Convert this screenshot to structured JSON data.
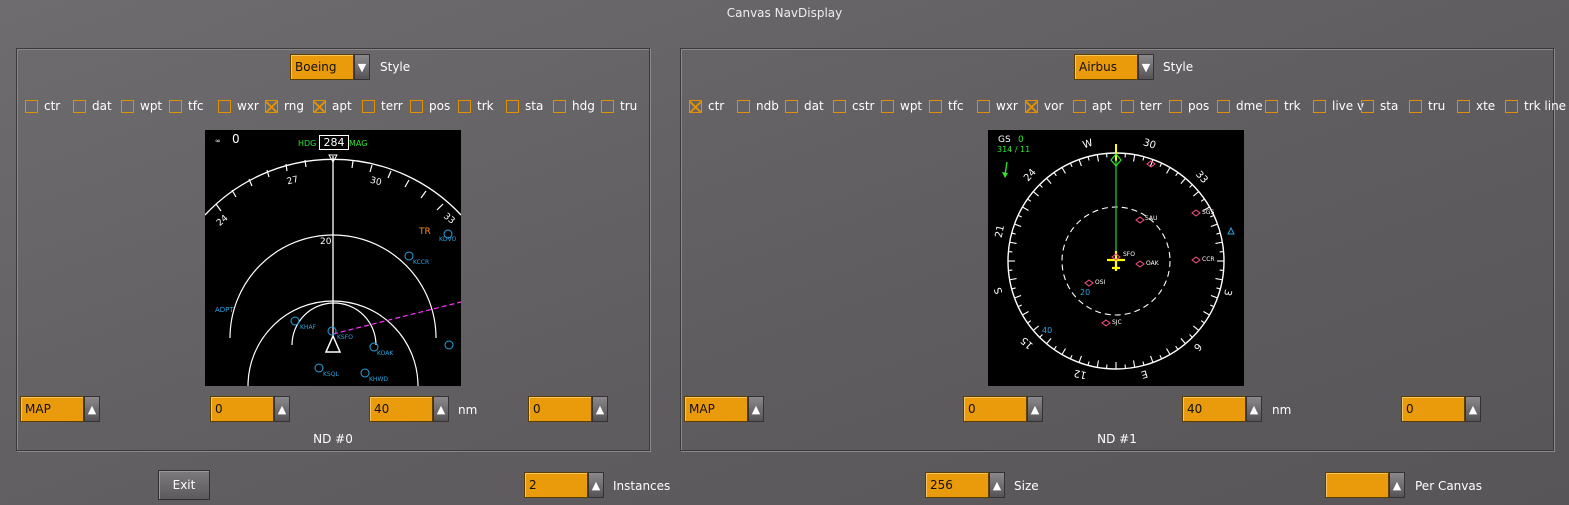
{
  "window": {
    "title": "Canvas NavDisplay"
  },
  "nd0": {
    "style": {
      "value": "Boeing",
      "label": "Style"
    },
    "checkboxes": [
      {
        "label": "ctr",
        "checked": false
      },
      {
        "label": "dat",
        "checked": false
      },
      {
        "label": "wpt",
        "checked": false
      },
      {
        "label": "tfc",
        "checked": false
      },
      {
        "label": "wxr",
        "checked": false
      },
      {
        "label": "rng",
        "checked": true
      },
      {
        "label": "apt",
        "checked": true
      },
      {
        "label": "terr",
        "checked": false
      },
      {
        "label": "pos",
        "checked": false
      },
      {
        "label": "trk",
        "checked": false
      },
      {
        "label": "sta",
        "checked": false
      },
      {
        "label": "hdg",
        "checked": false
      },
      {
        "label": "tru",
        "checked": false
      }
    ],
    "display": {
      "corner": "0",
      "hdg_label": "HDG",
      "heading": "284",
      "mag_label": "MAG",
      "ticks": [
        "24",
        "27",
        "30",
        "33"
      ],
      "range_label": "20",
      "airports": [
        "KSFO",
        "KOAK",
        "KSQL",
        "KHWD",
        "KHAF",
        "KCCR",
        "KDVO",
        "ADPT"
      ],
      "traffic": "TR"
    },
    "mode": "MAP",
    "field1": "0",
    "range": "40",
    "range_unit": "nm",
    "field3": "0",
    "caption": "ND #0"
  },
  "nd1": {
    "style": {
      "value": "Airbus",
      "label": "Style"
    },
    "checkboxes": [
      {
        "label": "ctr",
        "checked": true
      },
      {
        "label": "ndb",
        "checked": false
      },
      {
        "label": "dat",
        "checked": false
      },
      {
        "label": "cstr",
        "checked": false
      },
      {
        "label": "wpt",
        "checked": false
      },
      {
        "label": "tfc",
        "checked": false
      },
      {
        "label": "wxr",
        "checked": false
      },
      {
        "label": "vor",
        "checked": true
      },
      {
        "label": "apt",
        "checked": false
      },
      {
        "label": "terr",
        "checked": false
      },
      {
        "label": "pos",
        "checked": false
      },
      {
        "label": "dme",
        "checked": false
      },
      {
        "label": "trk",
        "checked": false
      },
      {
        "label": "live v",
        "checked": false
      },
      {
        "label": "sta",
        "checked": false
      },
      {
        "label": "tru",
        "checked": false
      },
      {
        "label": "xte",
        "checked": false
      },
      {
        "label": "trk line",
        "checked": false
      }
    ],
    "display": {
      "gs_label": "GS",
      "gs_value": "0",
      "wind": "314 / 11",
      "compass": [
        "W",
        "30",
        "33",
        "24",
        "21",
        "S",
        "15",
        "12",
        "E",
        "6",
        "3"
      ],
      "vors": [
        "SAU",
        "SGS",
        "SFO",
        "OAK",
        "OSI",
        "CCR",
        "SJC"
      ],
      "inner_ranges": [
        "20",
        "40"
      ]
    },
    "mode": "MAP",
    "field1": "0",
    "range": "40",
    "range_unit": "nm",
    "field3": "0",
    "caption": "ND #1"
  },
  "bottom": {
    "exit_label": "Exit",
    "instances_value": "2",
    "instances_label": "Instances",
    "size_value": "256",
    "size_label": "Size",
    "per_canvas_value": "",
    "per_canvas_label": "Per Canvas"
  },
  "icons": {
    "dropdown": "triangle-down-icon",
    "spin": "triangle-up-icon"
  },
  "colors": {
    "accent": "#e99b0c",
    "panel_bg": "#646264",
    "nd_bg": "#000000"
  }
}
